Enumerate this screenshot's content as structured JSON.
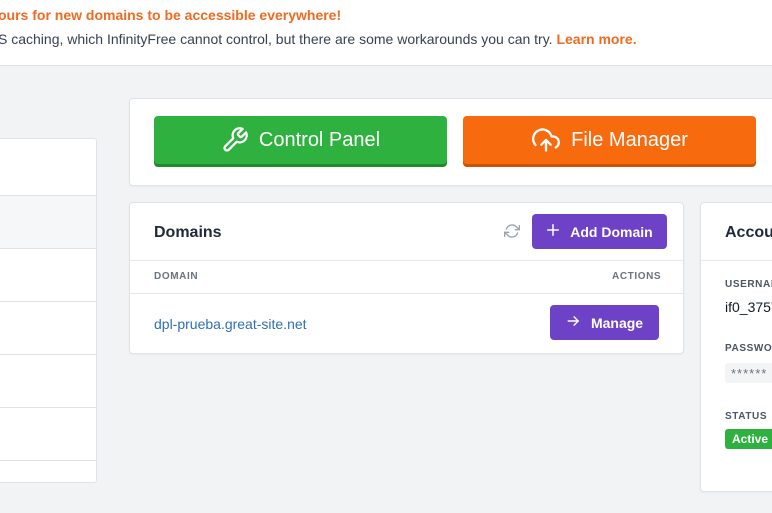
{
  "notice": {
    "title": "ours for new domains to be accessible everywhere!",
    "text": "S caching, which InfinityFree cannot control, but there are some workarounds you can try. ",
    "link": "Learn more."
  },
  "shortcuts": {
    "control_panel": "Control Panel",
    "file_manager": "File Manager"
  },
  "domains": {
    "title": "Domains",
    "add_button": "Add Domain",
    "columns": {
      "domain": "DOMAIN",
      "actions": "ACTIONS"
    },
    "rows": [
      {
        "domain": "dpl-prueba.great-site.net",
        "action": "Manage"
      }
    ]
  },
  "account": {
    "title": "Accou",
    "username_label": "USERNAM",
    "username_value": "if0_3757",
    "password_label": "PASSWOR",
    "password_value": "******",
    "status_label": "STATUS",
    "status_value": "Active"
  },
  "colors": {
    "accent_orange": "#f06a1f",
    "green": "#2eb13f",
    "orange_button": "#f86a0e",
    "purple": "#6d42c7",
    "link_blue": "#2f6fb5"
  }
}
